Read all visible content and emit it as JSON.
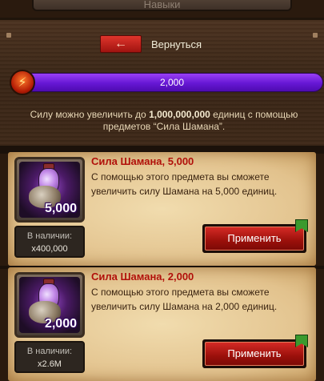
{
  "top_tab": {
    "label": "Навыки"
  },
  "back": {
    "label": "Вернуться"
  },
  "power": {
    "value": "2,000"
  },
  "hint": {
    "prefix": "Силу можно увеличить до",
    "amount": "1,000,000,000",
    "suffix": "единиц с помощью предметов “Сила Шамана”."
  },
  "items": [
    {
      "title": "Сила Шамана, 5,000",
      "description": "С помощью этого предмета вы сможете увеличить силу Шамана на 5,000 единиц.",
      "qty_badge": "5,000",
      "stock_label": "В наличии:",
      "stock_value": "x400,000",
      "apply_label": "Применить"
    },
    {
      "title": "Сила Шамана, 2,000",
      "description": "С помощью этого предмета вы сможете увеличить силу Шамана на 2,000 единиц.",
      "qty_badge": "2,000",
      "stock_label": "В наличии:",
      "stock_value": "x2.6M",
      "apply_label": "Применить"
    }
  ],
  "icons": {
    "back": "arrow-left-icon",
    "power": "lightning-icon",
    "item": "shaman-power-potion-icon"
  },
  "colors": {
    "power_bar": "#6617d4",
    "button_red": "#b41510",
    "title_red": "#b1100a"
  }
}
